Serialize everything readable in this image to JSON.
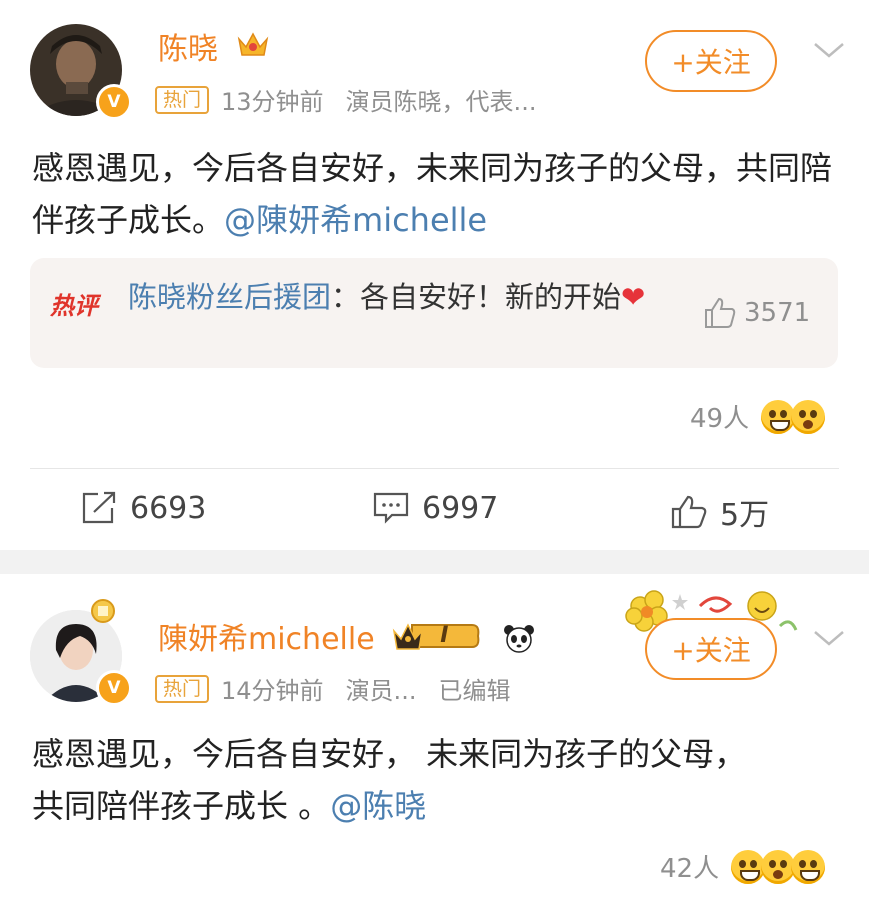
{
  "posts": [
    {
      "username": "陈晓",
      "hot_tag": "热门",
      "time": "13分钟前",
      "source": "演员陈晓，代表...",
      "edited": "",
      "follow_label": "+关注",
      "content_text": "感恩遇见，今后各自安好，未来同为孩子的父母，共同陪伴孩子成长。",
      "mention": "@陳妍希michelle",
      "hot_comment": {
        "logo": "热评",
        "author": "陈晓粉丝后援团",
        "text": "：各自安好！新的开始",
        "heart": "❤",
        "likes": "3571"
      },
      "reactions": "49人",
      "reaction_icons": [
        "grin-emoji-icon",
        "surprised-emoji-icon"
      ],
      "actions": {
        "repost": "6693",
        "comment": "6997",
        "like": "5万"
      }
    },
    {
      "username": "陳妍希michelle",
      "level_badge": "I",
      "hot_tag": "热门",
      "time": "14分钟前",
      "source": "演员...",
      "edited": "已编辑",
      "follow_label": "+关注",
      "content_text": "感恩遇见，今后各自安好， 未来同为孩子的父母， 共同陪伴孩子成长 。",
      "mention": "@陈晓",
      "reactions": "42人",
      "reaction_icons": [
        "laugh-emoji-icon",
        "surprised-emoji-icon",
        "grin-emoji-icon"
      ]
    }
  ],
  "colors": {
    "username": "#f08326",
    "mention": "#4c7fb0",
    "follow": "#f28c28",
    "hot_tag": "#e8a33a",
    "hot_logo": "#e0342b",
    "verified_badge": "#f7a21b",
    "separator": "#f2f2f2"
  }
}
